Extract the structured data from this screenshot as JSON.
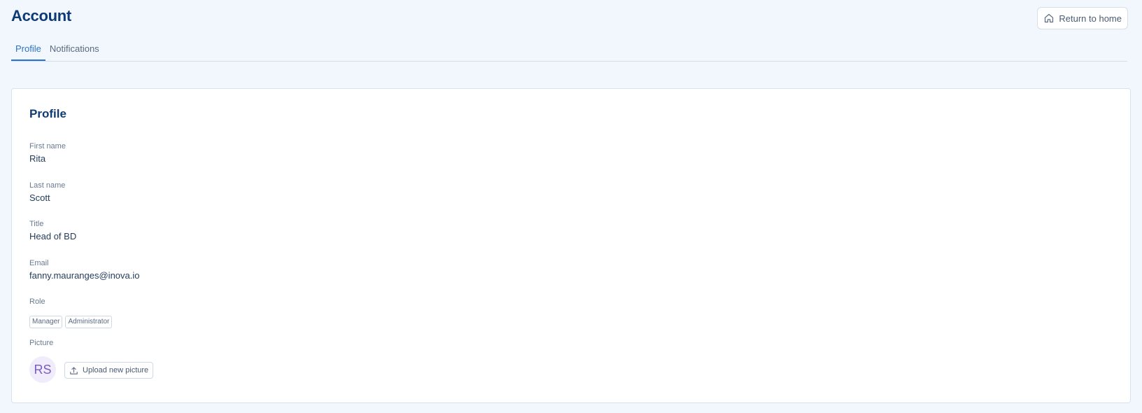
{
  "header": {
    "title": "Account",
    "return_label": "Return to home"
  },
  "tabs": [
    {
      "label": "Profile",
      "active": true
    },
    {
      "label": "Notifications",
      "active": false
    }
  ],
  "profile": {
    "title": "Profile",
    "fields": {
      "first_name": {
        "label": "First name",
        "value": "Rita"
      },
      "last_name": {
        "label": "Last name",
        "value": "Scott"
      },
      "title": {
        "label": "Title",
        "value": "Head of BD"
      },
      "email": {
        "label": "Email",
        "value": "fanny.mauranges@inova.io"
      }
    },
    "role": {
      "label": "Role",
      "tags": [
        "Manager",
        "Administrator"
      ]
    },
    "picture": {
      "label": "Picture",
      "initials": "RS",
      "upload_label": "Upload new picture"
    }
  },
  "colors": {
    "accent": "#2a73c9",
    "heading": "#0f3b75",
    "background": "#f1f7fd",
    "avatar_bg": "#f0ecfb",
    "avatar_text": "#7a5bbf"
  },
  "icons": {
    "return": "home-icon",
    "upload": "upload-icon"
  }
}
